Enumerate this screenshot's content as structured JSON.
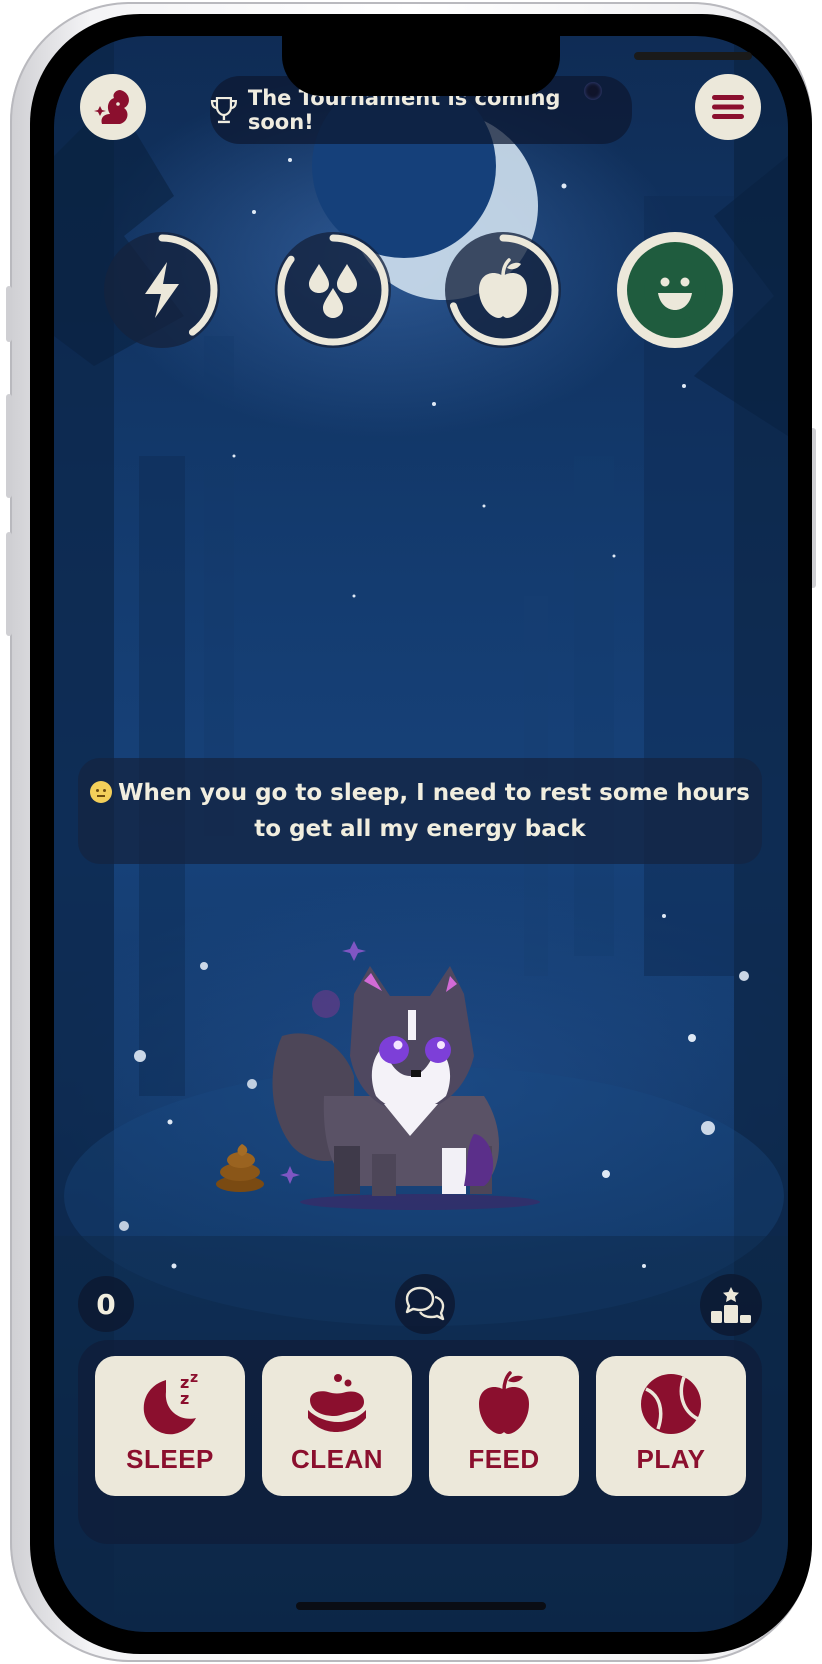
{
  "banner": {
    "text": "The Tournament is coming soon!",
    "icon": "trophy-icon"
  },
  "header": {
    "logo_icon": "squirrel-logo-icon",
    "menu_icon": "hamburger-menu-icon"
  },
  "stats": [
    {
      "name": "energy",
      "icon": "lightning-icon",
      "level": 0.4
    },
    {
      "name": "hygiene",
      "icon": "water-drops-icon",
      "level": 0.85
    },
    {
      "name": "hunger",
      "icon": "apple-icon",
      "level": 0.7
    },
    {
      "name": "happiness",
      "icon": "smiley-icon",
      "level": 1.0
    }
  ],
  "speech": {
    "text": "When you go to sleep, I need to rest some hours to get all my energy back"
  },
  "counter": {
    "value": "0"
  },
  "actions": [
    {
      "label": "SLEEP",
      "icon": "moon-zzz-icon"
    },
    {
      "label": "CLEAN",
      "icon": "soap-icon"
    },
    {
      "label": "FEED",
      "icon": "apple-icon"
    },
    {
      "label": "PLAY",
      "icon": "ball-icon"
    }
  ],
  "colors": {
    "accent": "#8b0f2e",
    "cream": "#ece8da",
    "happy_green": "#1f5c3e",
    "sky": "#133a6d"
  }
}
